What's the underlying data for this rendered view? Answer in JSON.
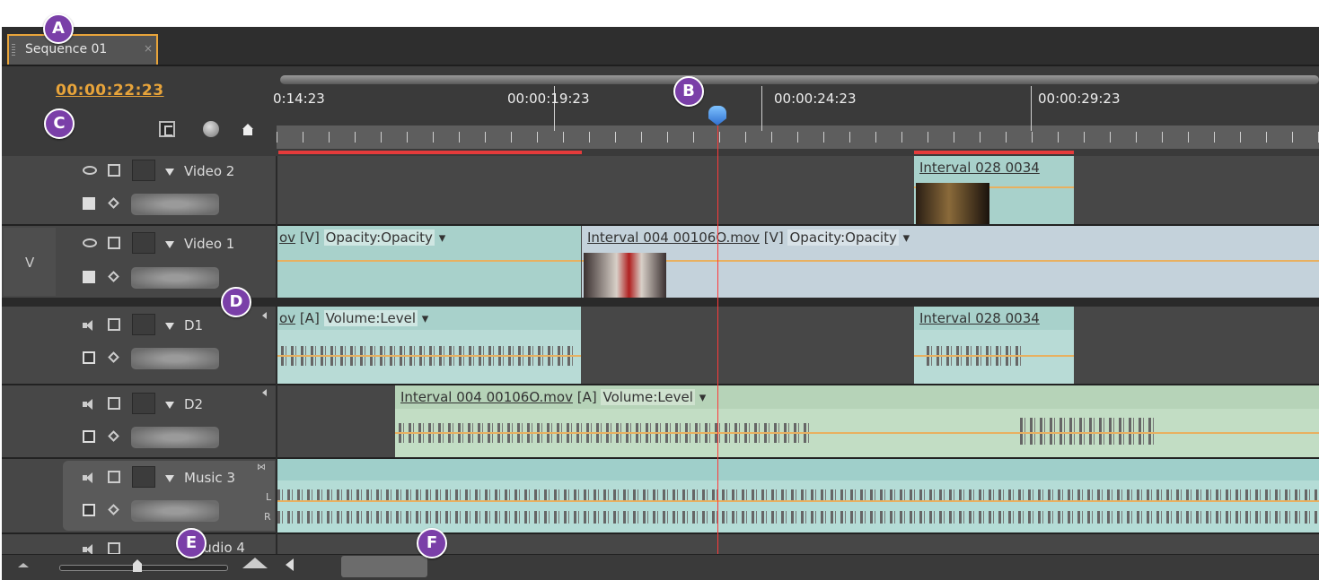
{
  "tab": {
    "title": "Sequence 01",
    "close": "×"
  },
  "timecode": "00:00:22:23",
  "ruler": {
    "labels": [
      "0:14:23",
      "00:00:19:23",
      "00:00:24:23",
      "00:00:29:23"
    ]
  },
  "tracks": {
    "video2": {
      "name": "Video 2"
    },
    "video1": {
      "name": "Video 1",
      "target": "V"
    },
    "d1": {
      "name": "D1"
    },
    "d2": {
      "name": "D2"
    },
    "music3": {
      "name": "Music 3",
      "left": "L",
      "right": "R"
    },
    "track4": {
      "name": "Audio 4"
    }
  },
  "clips": {
    "v2_interval028": {
      "name": "Interval 028 0034"
    },
    "v1_prev_tail": {
      "name": "ov",
      "suffix": " [V] ",
      "effect": "Opacity:Opacity"
    },
    "v1_interval004": {
      "name": "Interval 004 00106O.mov",
      "suffix": " [V] ",
      "effect": "Opacity:Opacity"
    },
    "d1_prev_tail": {
      "name": "ov",
      "suffix": " [A] ",
      "effect": "Volume:Level"
    },
    "d1_interval028": {
      "name": "Interval 028 0034"
    },
    "d2_interval004": {
      "name": "Interval 004 00106O.mov",
      "suffix": " [A] ",
      "effect": "Volume:Level"
    }
  },
  "callouts": {
    "a": "A",
    "b": "B",
    "c": "C",
    "d": "D",
    "e": "E",
    "f": "F"
  },
  "colors": {
    "timecode": "#e8a43a",
    "playhead": "#ff3a3a",
    "clip": "#a8d1cb",
    "callout": "#7a3fa8"
  },
  "icons": [
    "eye-icon",
    "speaker-icon",
    "lock-icon",
    "snap-icon",
    "marker-icon",
    "home-icon",
    "keyframe-icon",
    "zoom-out-icon",
    "zoom-in-icon"
  ]
}
